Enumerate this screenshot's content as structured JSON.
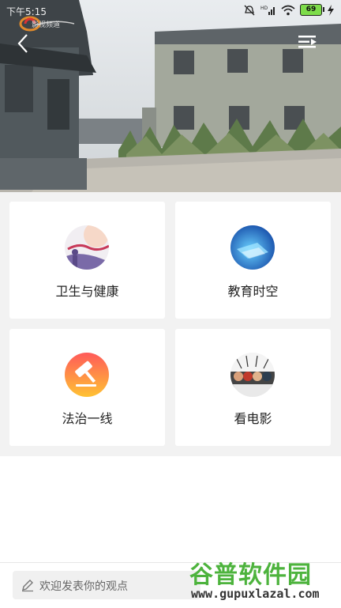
{
  "status": {
    "time": "下午5:15",
    "battery": "69"
  },
  "logo": {
    "text": "影视频道"
  },
  "categories": [
    {
      "label": "卫生与健康",
      "icon": "health-thumbnail"
    },
    {
      "label": "教育时空",
      "icon": "education-thumbnail"
    },
    {
      "label": "法治一线",
      "icon": "gavel-icon"
    },
    {
      "label": "看电影",
      "icon": "movie-thumbnail"
    }
  ],
  "comment": {
    "placeholder": "欢迎发表你的观点"
  },
  "watermark": {
    "title": "谷普软件园",
    "url": "www.gupuxlazal.com"
  },
  "colors": {
    "gavel_gradient_top": "#ff5a5a",
    "gavel_gradient_bottom": "#ffc233",
    "watermark_green": "#4db33d"
  }
}
